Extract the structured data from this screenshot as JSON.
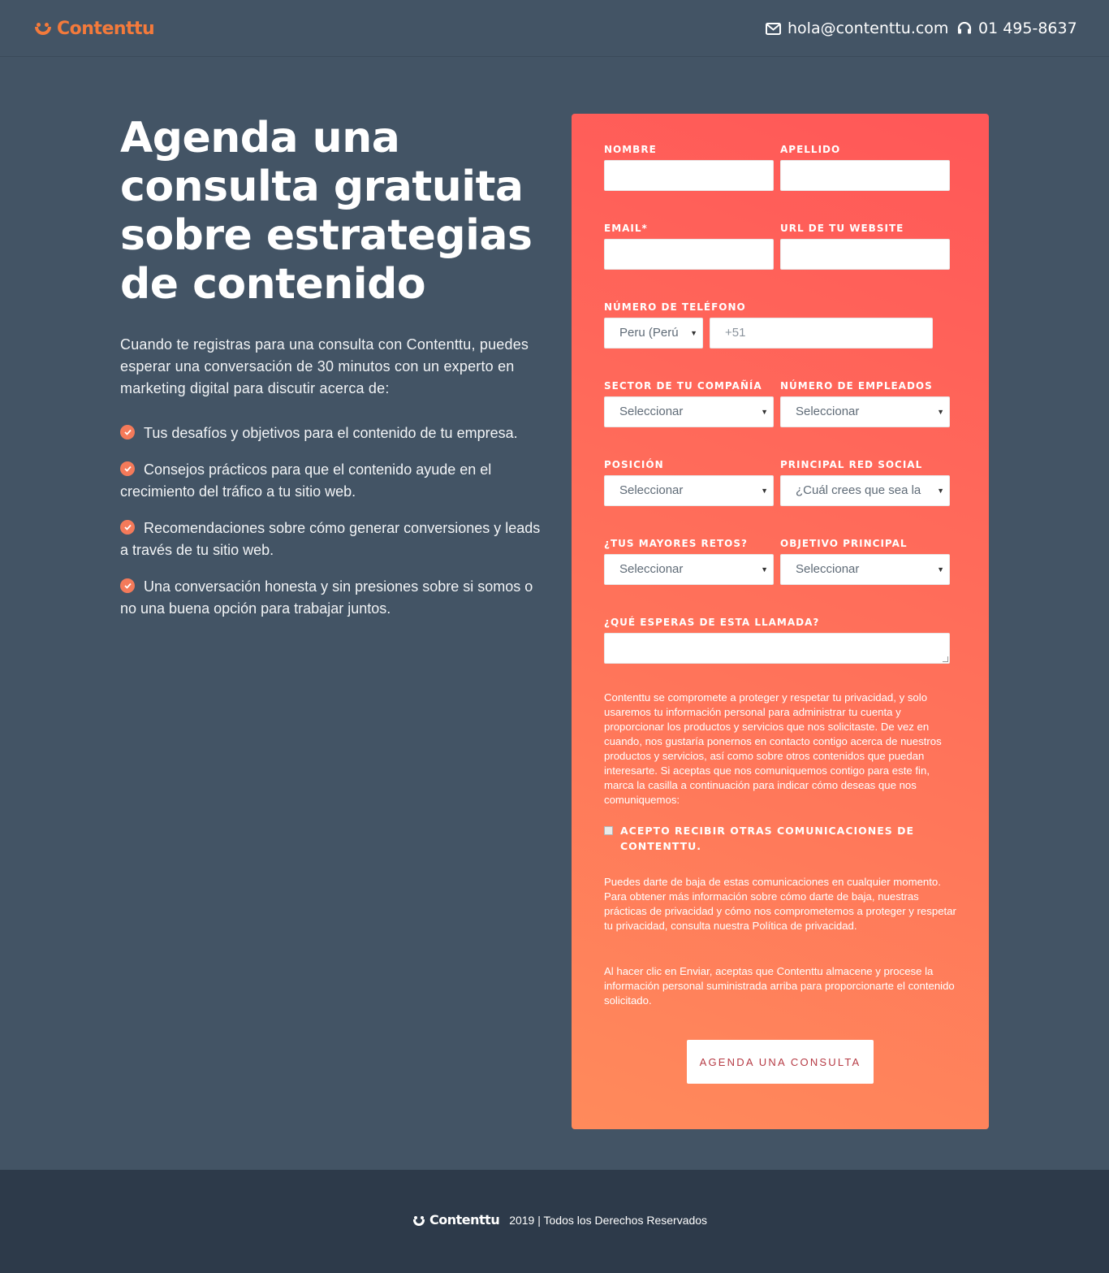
{
  "header": {
    "logo_text": "Contenttu",
    "email": "hola@contenttu.com",
    "phone": "01 495-8637",
    "email_icon": "envelope-icon",
    "phone_icon": "headset-icon"
  },
  "hero": {
    "headline": "Agenda una consulta gratuita sobre estrategias de contenido",
    "intro": "Cuando te registras para una consulta con Contenttu, puedes esperar una conversación de 30 minutos con un experto en marketing digital para discutir acerca de:",
    "benefits": [
      "Tus desafíos y objetivos para el contenido de tu empresa.",
      "Consejos prácticos para que el contenido ayude en el crecimiento del tráfico a tu sitio web.",
      "Recomendaciones sobre cómo generar conversiones y leads a través de tu sitio web.",
      "Una conversación honesta y sin presiones sobre si somos o no una buena opción para trabajar juntos."
    ]
  },
  "form": {
    "nombre_label": "NOMBRE",
    "apellido_label": "APELLIDO",
    "email_label": "EMAIL*",
    "website_label": "URL DE TU WEBSITE",
    "phone_label": "NÚMERO DE TELÉFONO",
    "country_value": "Peru (Perú",
    "phone_placeholder": "+51",
    "sector_label": "SECTOR DE TU COMPAÑÍA",
    "sector_value": "Seleccionar",
    "employees_label": "NÚMERO DE EMPLEADOS",
    "employees_value": "Seleccionar",
    "position_label": "POSICIÓN",
    "position_value": "Seleccionar",
    "social_label": "PRINCIPAL RED SOCIAL",
    "social_value": "¿Cuál crees que sea la",
    "challenges_label": "¿TUS MAYORES RETOS?",
    "challenges_value": "Seleccionar",
    "objective_label": "OBJETIVO PRINCIPAL",
    "objective_value": "Seleccionar",
    "expect_label": "¿QUÉ ESPERAS DE ESTA LLAMADA?",
    "privacy_text": "Contenttu se compromete a proteger y respetar tu privacidad, y solo usaremos tu información personal para administrar tu cuenta y proporcionar los productos y servicios que nos solicitaste. De vez en cuando, nos gustaría ponernos en contacto contigo acerca de nuestros productos y servicios, así como sobre otros contenidos que puedan interesarte. Si aceptas que nos comuniquemos contigo para este fin, marca la casilla a continuación para indicar cómo deseas que nos comuniquemos:",
    "consent_label": "ACEPTO RECIBIR OTRAS COMUNICACIONES DE CONTENTTU.",
    "unsubscribe_text": "Puedes darte de baja de estas comunicaciones en cualquier momento. Para obtener más información sobre cómo darte de baja, nuestras prácticas de privacidad y cómo nos comprometemos a proteger y respetar tu privacidad, consulta nuestra Política de privacidad.",
    "submit_notice": "Al hacer clic en Enviar, aceptas que Contenttu almacene y procese la información personal suministrada arriba para proporcionarte el contenido solicitado.",
    "submit_label": "AGENDA UNA CONSULTA"
  },
  "footer": {
    "logo_text": "Contenttu",
    "copyright": "2019 | Todos los Derechos Reservados"
  },
  "colors": {
    "background": "#435465",
    "accent": "#f47a3b",
    "form_gradient_top": "#ff5758",
    "form_gradient_bottom": "#ff8a5b",
    "footer": "#2d3a4a",
    "button_text": "#b63b45"
  }
}
